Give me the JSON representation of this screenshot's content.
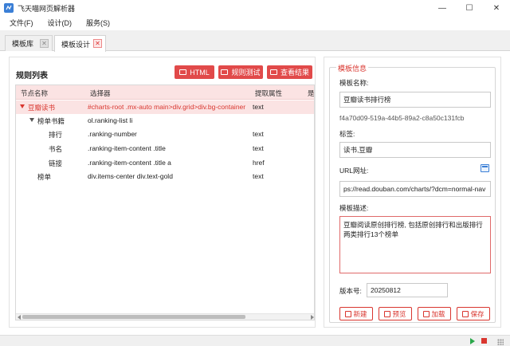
{
  "window": {
    "title": "飞天喵网页解析器",
    "controls": {
      "minimize": "—",
      "maximize": "☐",
      "close": "✕"
    }
  },
  "menu": [
    "文件(F)",
    "设计(D)",
    "服务(S)"
  ],
  "tabs": [
    {
      "label": "模板库",
      "close": "✕",
      "active": false
    },
    {
      "label": "模板设计",
      "close": "✕",
      "active": true
    }
  ],
  "rules": {
    "title": "规则列表",
    "buttons": {
      "html": "HTML",
      "test": "规则测试",
      "view": "查看结果"
    },
    "columns": [
      "节点名称",
      "选择器",
      "提取属性",
      "是"
    ],
    "rows": [
      {
        "name": "豆瓣读书",
        "selector": "#charts-root .mx-auto main>div.grid>div.bg-container",
        "attr": "text",
        "expanded": true,
        "selected": true
      },
      {
        "name": "榜单书籍",
        "selector": "ol.ranking-list li",
        "attr": "",
        "expanded": true,
        "selected": false
      },
      {
        "name": "排行",
        "selector": ".ranking-number",
        "attr": "text",
        "selected": false
      },
      {
        "name": "书名",
        "selector": ".ranking-item-content .title",
        "attr": "text",
        "selected": false
      },
      {
        "name": "链接",
        "selector": ".ranking-item-content .title a",
        "attr": "href",
        "selected": false
      },
      {
        "name": "榜单",
        "selector": "div.items-center div.text-gold",
        "attr": "text",
        "selected": false
      }
    ]
  },
  "template_info": {
    "legend": "模板信息",
    "name_label": "模板名称:",
    "name_value": "豆瓣读书排行榜",
    "uuid": "f4a70d09-519a-44b5-89a2-c8a50c131fcb",
    "tags_label": "标签:",
    "tags_value": "读书,豆瓣",
    "url_label": "URL网址:",
    "url_value": "ps://read.douban.com/charts/?dcm=normal-nav",
    "desc_label": "模板描述:",
    "desc_value": "豆瓣阅读原创排行榜, 包括原创排行和出版排行两类排行13个榜单",
    "version_label": "版本号:",
    "version_value": "20250812",
    "buttons": {
      "new": "新建",
      "preview": "预览",
      "load": "加载",
      "save": "保存"
    }
  },
  "status": {
    "run_icon": "play-icon",
    "stop_icon": "stop-icon"
  },
  "colors": {
    "accent": "#e14a4a",
    "selected_row": "#fbe3e3",
    "app_icon": "#3b7fd6"
  }
}
